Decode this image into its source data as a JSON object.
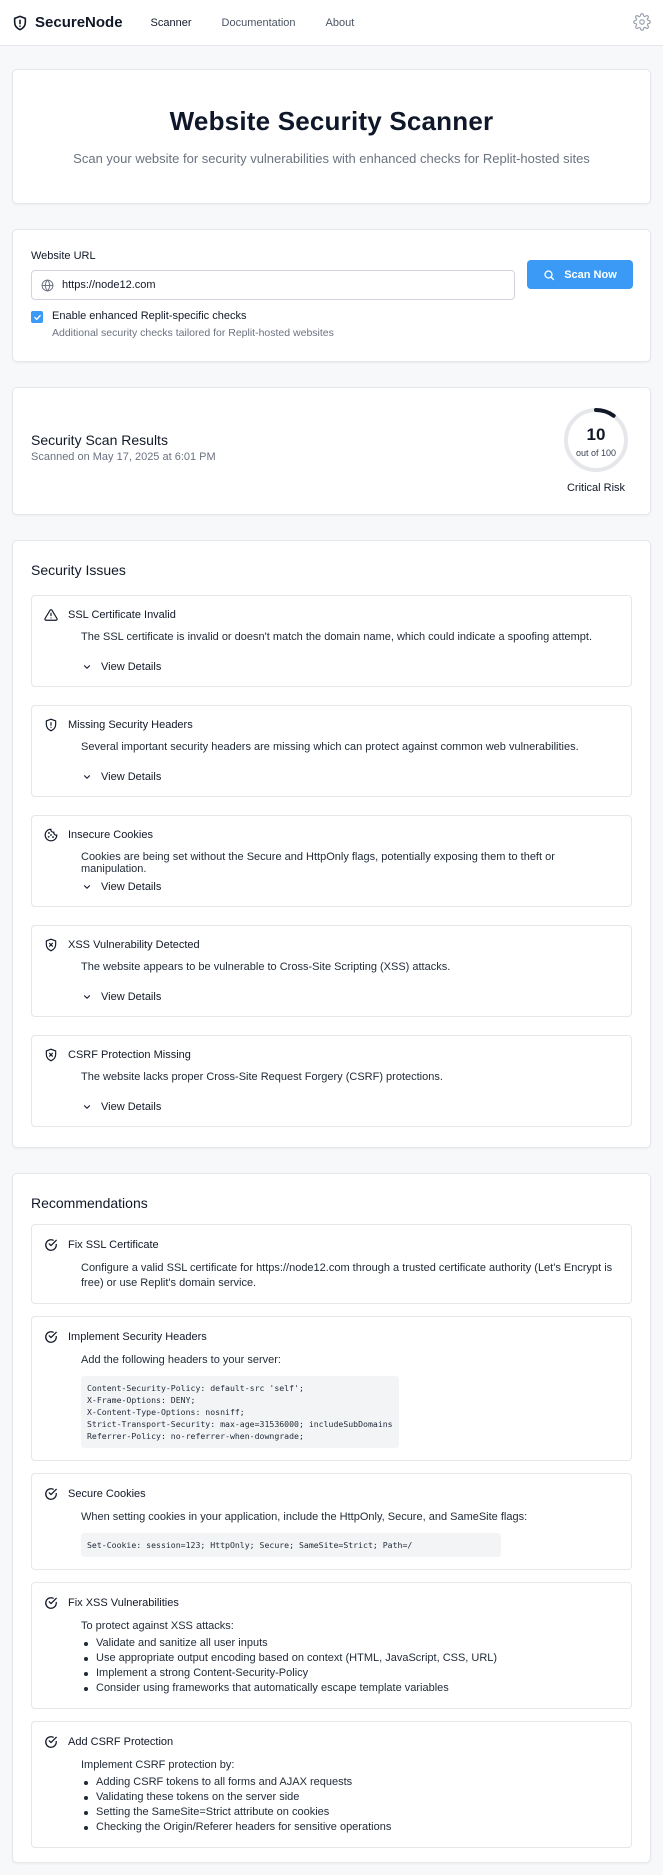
{
  "nav": {
    "brand": "SecureNode",
    "links": [
      "Scanner",
      "Documentation",
      "About"
    ]
  },
  "hero": {
    "title": "Website Security Scanner",
    "subtitle": "Scan your website for security vulnerabilities with enhanced checks for Replit-hosted sites"
  },
  "scan": {
    "url_label": "Website URL",
    "url_value": "https://node12.com",
    "button_label": "Scan Now",
    "checkbox_label": "Enable enhanced Replit-specific checks",
    "checkbox_hint": "Additional security checks tailored for Replit-hosted websites",
    "checkbox_checked": true
  },
  "results": {
    "title": "Security Scan Results",
    "scanned_on": "Scanned on May 17, 2025 at 6:01 PM",
    "score": "10",
    "score_max": "out of 100",
    "score_value": 10,
    "risk_label": "Critical Risk",
    "gauge_color": "#111827"
  },
  "issues": {
    "title": "Security Issues",
    "details_label": "View Details",
    "items": [
      {
        "icon": "warning-triangle-icon",
        "title": "SSL Certificate Invalid",
        "desc": "The SSL certificate is invalid or doesn't match the domain name, which could indicate a spoofing attempt."
      },
      {
        "icon": "shield-alert-icon",
        "title": "Missing Security Headers",
        "desc": "Several important security headers are missing which can protect against common web vulnerabilities."
      },
      {
        "icon": "cookie-icon",
        "title": "Insecure Cookies",
        "desc": "Cookies are being set without the Secure and HttpOnly flags, potentially exposing them to theft or manipulation."
      },
      {
        "icon": "shield-x-icon",
        "title": "XSS Vulnerability Detected",
        "desc": "The website appears to be vulnerable to Cross-Site Scripting (XSS) attacks."
      },
      {
        "icon": "shield-x-icon",
        "title": "CSRF Protection Missing",
        "desc": "The website lacks proper Cross-Site Request Forgery (CSRF) protections."
      }
    ]
  },
  "recommendations": {
    "title": "Recommendations",
    "items": [
      {
        "title": "Fix SSL Certificate",
        "text": "Configure a valid SSL certificate for https://node12.com through a trusted certificate authority (Let's Encrypt is free) or use Replit's domain service."
      },
      {
        "title": "Implement Security Headers",
        "text": "Add the following headers to your server:",
        "code": "Content-Security-Policy: default-src 'self';\nX-Frame-Options: DENY;\nX-Content-Type-Options: nosniff;\nStrict-Transport-Security: max-age=31536000; includeSubDomains\nReferrer-Policy: no-referrer-when-downgrade;"
      },
      {
        "title": "Secure Cookies",
        "text": "When setting cookies in your application, include the HttpOnly, Secure, and SameSite flags:",
        "code": "Set-Cookie: session=123; HttpOnly; Secure; SameSite=Strict; Path=/"
      },
      {
        "title": "Fix XSS Vulnerabilities",
        "text": "To protect against XSS attacks:",
        "bullets": [
          "Validate and sanitize all user inputs",
          "Use appropriate output encoding based on context (HTML, JavaScript, CSS, URL)",
          "Implement a strong Content-Security-Policy",
          "Consider using frameworks that automatically escape template variables"
        ]
      },
      {
        "title": "Add CSRF Protection",
        "text": "Implement CSRF protection by:",
        "bullets": [
          "Adding CSRF tokens to all forms and AJAX requests",
          "Validating these tokens on the server side",
          "Setting the SameSite=Strict attribute on cookies",
          "Checking the Origin/Referer headers for sensitive operations"
        ]
      }
    ]
  }
}
